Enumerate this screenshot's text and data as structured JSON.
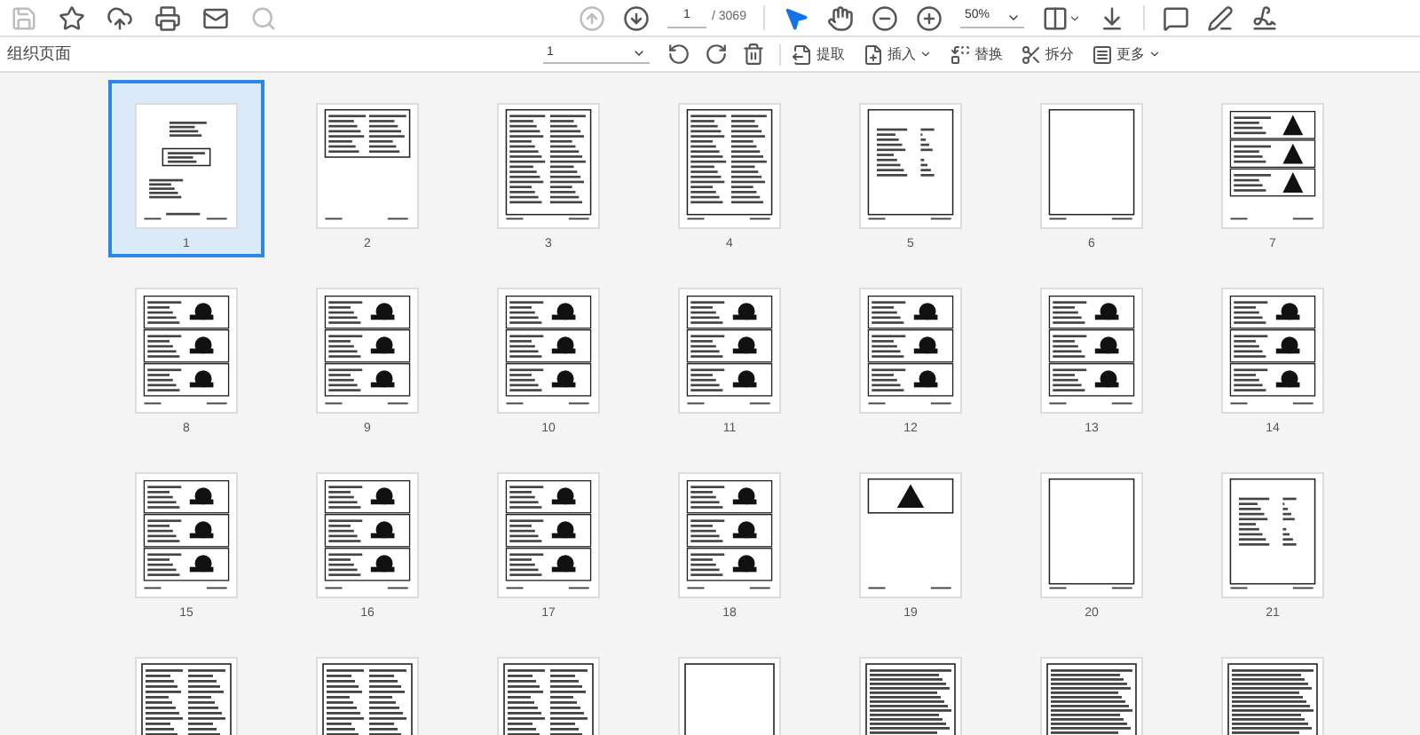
{
  "main_toolbar": {
    "buttons": [
      {
        "disabled": true
      },
      {
        "disabled": false
      },
      {
        "disabled": false
      },
      {
        "disabled": false
      },
      {
        "disabled": false
      },
      {
        "disabled": true
      }
    ],
    "page_nav": {
      "up_disabled": true,
      "down_disabled": false,
      "page": "1",
      "total": "/ 3069"
    },
    "zoom": "50%"
  },
  "organize_toolbar": {
    "title": "组织页面",
    "page_range": "1",
    "actions": [
      {
        "label": "提取",
        "dropdown": false
      },
      {
        "label": "插入",
        "dropdown": true
      },
      {
        "label": "替换",
        "dropdown": false
      },
      {
        "label": "拆分",
        "dropdown": false
      },
      {
        "label": "更多",
        "dropdown": true
      }
    ]
  },
  "pages": [
    {
      "label": "1",
      "kind": "cover",
      "selected": true
    },
    {
      "label": "2",
      "kind": "text",
      "selected": false
    },
    {
      "label": "3",
      "kind": "columns",
      "selected": false
    },
    {
      "label": "4",
      "kind": "columns",
      "selected": false
    },
    {
      "label": "5",
      "kind": "list",
      "selected": false
    },
    {
      "label": "6",
      "kind": "blank",
      "selected": false
    },
    {
      "label": "7",
      "kind": "warning",
      "selected": false
    },
    {
      "label": "8",
      "kind": "figure",
      "selected": false
    },
    {
      "label": "9",
      "kind": "figure",
      "selected": false
    },
    {
      "label": "10",
      "kind": "figure",
      "selected": false
    },
    {
      "label": "11",
      "kind": "figure",
      "selected": false
    },
    {
      "label": "12",
      "kind": "figure",
      "selected": false
    },
    {
      "label": "13",
      "kind": "figure",
      "selected": false
    },
    {
      "label": "14",
      "kind": "figure",
      "selected": false
    },
    {
      "label": "15",
      "kind": "figure",
      "selected": false
    },
    {
      "label": "16",
      "kind": "figure",
      "selected": false
    },
    {
      "label": "17",
      "kind": "figure",
      "selected": false
    },
    {
      "label": "18",
      "kind": "figure",
      "selected": false
    },
    {
      "label": "19",
      "kind": "sign",
      "selected": false
    },
    {
      "label": "20",
      "kind": "blank",
      "selected": false
    },
    {
      "label": "21",
      "kind": "list",
      "selected": false
    },
    {
      "kind": "columns",
      "selected": false
    },
    {
      "kind": "columns",
      "selected": false
    },
    {
      "kind": "columns",
      "selected": false
    },
    {
      "kind": "blank",
      "selected": false
    },
    {
      "kind": "table",
      "selected": false
    },
    {
      "kind": "table",
      "selected": false
    },
    {
      "kind": "table",
      "selected": false
    }
  ]
}
